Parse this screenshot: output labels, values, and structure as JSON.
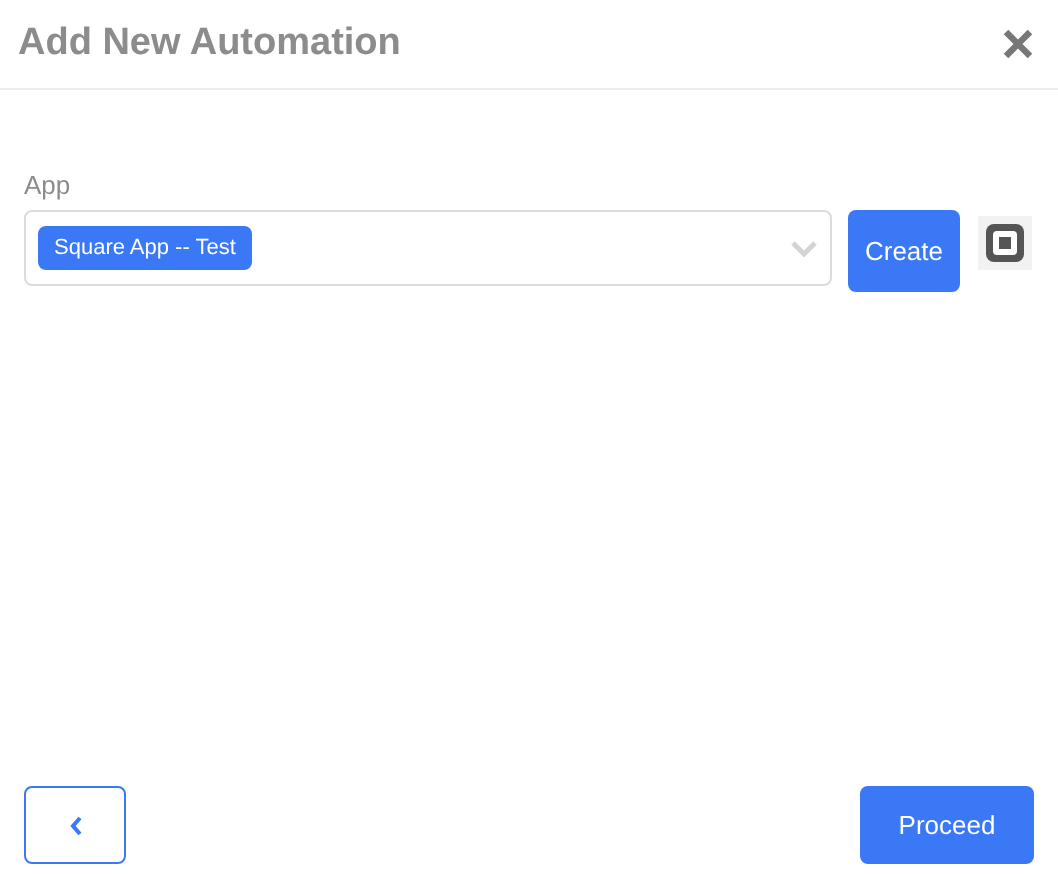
{
  "dialog": {
    "title": "Add New Automation"
  },
  "app_field": {
    "label": "App",
    "chip": "Square App -- Test",
    "create_button": "Create"
  },
  "footer": {
    "proceed_button": "Proceed"
  }
}
